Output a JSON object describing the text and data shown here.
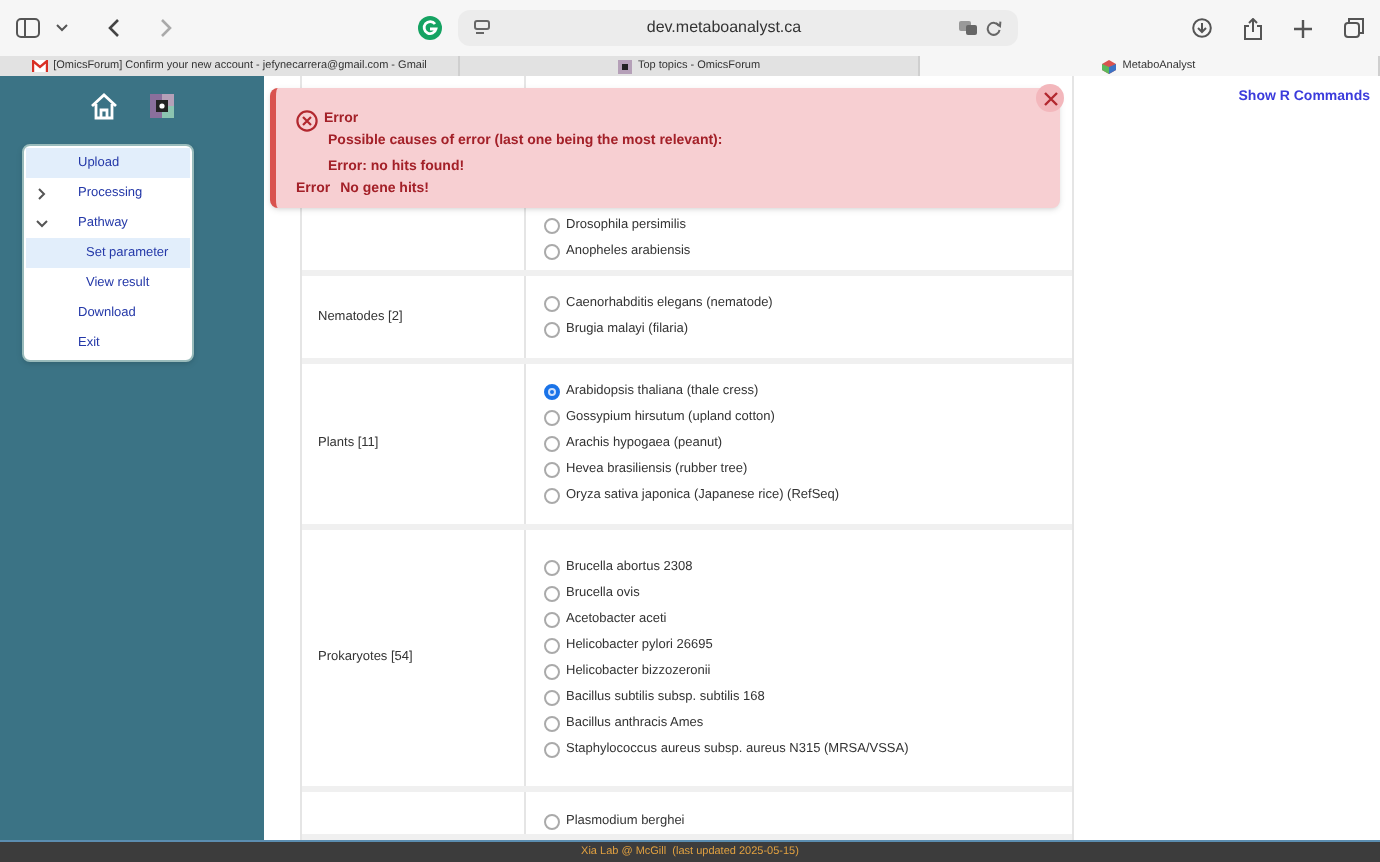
{
  "browser": {
    "url": "dev.metaboanalyst.ca",
    "tabs": [
      {
        "title": "[OmicsForum] Confirm your new account - jefynecarrera@gmail.com - Gmail",
        "kind": "mail",
        "selected": false
      },
      {
        "title": "Top topics - OmicsForum",
        "kind": "forum",
        "selected": false
      },
      {
        "title": "MetaboAnalyst",
        "kind": "app",
        "selected": true
      }
    ]
  },
  "sidebar": {
    "menu": [
      {
        "label": "Upload",
        "selected": true
      },
      {
        "label": "Processing",
        "selected": false,
        "expanded": false
      },
      {
        "label": "Pathway",
        "selected": false,
        "expanded": true,
        "children": [
          {
            "label": "Set parameter",
            "selected": true
          },
          {
            "label": "View result",
            "selected": false
          }
        ]
      },
      {
        "label": "Download",
        "selected": false
      },
      {
        "label": "Exit",
        "selected": false
      }
    ]
  },
  "alert": {
    "title": "Error",
    "lines": [
      "Possible causes of error (last one being the most relevant):",
      "Error: no hits found!"
    ],
    "final_label": "Error",
    "final_message": "No gene hits!"
  },
  "table": {
    "rows": [
      {
        "options": [
          {
            "name": "Drosophila persimilis",
            "selected": false
          },
          {
            "name": "Anopheles arabiensis",
            "selected": false
          }
        ]
      },
      {
        "label": "Nematodes [2]",
        "options": [
          {
            "name": "Caenorhabditis elegans (nematode)",
            "selected": false
          },
          {
            "name": "Brugia malayi (filaria)",
            "selected": false
          }
        ]
      },
      {
        "label": "Plants [11]",
        "options": [
          {
            "name": "Arabidopsis thaliana (thale cress)",
            "selected": true
          },
          {
            "name": "Gossypium hirsutum (upland cotton)",
            "selected": false
          },
          {
            "name": "Arachis hypogaea (peanut)",
            "selected": false
          },
          {
            "name": "Hevea brasiliensis (rubber tree)",
            "selected": false
          },
          {
            "name": "Oryza sativa japonica (Japanese rice) (RefSeq)",
            "selected": false
          }
        ]
      },
      {
        "label": "Prokaryotes [54]",
        "options": [
          {
            "name": "Brucella abortus 2308",
            "selected": false
          },
          {
            "name": "Brucella ovis",
            "selected": false
          },
          {
            "name": "Acetobacter aceti",
            "selected": false
          },
          {
            "name": "Helicobacter pylori 26695",
            "selected": false
          },
          {
            "name": "Helicobacter bizzozeronii",
            "selected": false
          },
          {
            "name": "Bacillus subtilis subsp. subtilis 168",
            "selected": false
          },
          {
            "name": "Bacillus anthracis Ames",
            "selected": false
          },
          {
            "name": "Staphylococcus aureus subsp. aureus N315 (MRSA/VSSA)",
            "selected": false
          }
        ]
      },
      {
        "options": [
          {
            "name": "Plasmodium berghei",
            "selected": false
          }
        ]
      }
    ]
  },
  "right_panel": {
    "link": "Show R Commands"
  },
  "footer": {
    "text": "Xia Lab @ McGill  (last updated 2025-05-15)"
  }
}
